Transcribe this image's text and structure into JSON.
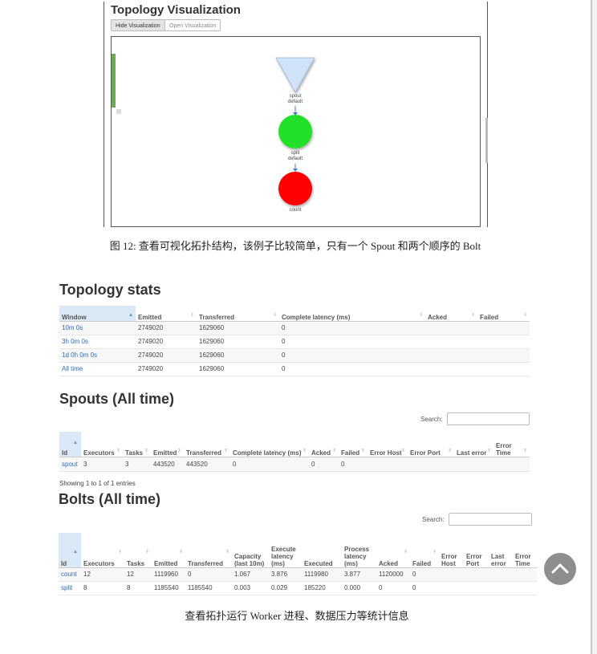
{
  "viz": {
    "title": "Topology Visualization",
    "hide_button": "Hide Visualization",
    "open_button": "Open Visualization",
    "nodes": [
      {
        "label_lines": [
          "spout",
          "default"
        ],
        "shape": "triangle",
        "color": "#cfe2f7"
      },
      {
        "label_lines": [
          "split",
          "default"
        ],
        "shape": "circle",
        "color": "#22e02a"
      },
      {
        "label_lines": [
          "count"
        ],
        "shape": "circle",
        "color": "#ff0000"
      }
    ]
  },
  "caption1": "图 12: 查看可视化拓扑结构，该例子比较简单，只有一个 Spout 和两个顺序的 Bolt",
  "stats": {
    "title": "Topology stats",
    "headers": [
      "Window",
      "Emitted",
      "Transferred",
      "Complete latency (ms)",
      "Acked",
      "Failed"
    ],
    "rows": [
      [
        "10m 0s",
        "2749020",
        "1629060",
        "0",
        "",
        ""
      ],
      [
        "3h 0m 0s",
        "2749020",
        "1629060",
        "0",
        "",
        ""
      ],
      [
        "1d 0h 0m 0s",
        "2749020",
        "1629060",
        "0",
        "",
        ""
      ],
      [
        "All time",
        "2749020",
        "1629060",
        "0",
        "",
        ""
      ]
    ]
  },
  "spouts": {
    "title": "Spouts (All time)",
    "search_label": "Search:",
    "headers": [
      "Id",
      "Executors",
      "Tasks",
      "Emitted",
      "Transferred",
      "Complete latency (ms)",
      "Acked",
      "Failed",
      "Error Host",
      "Error Port",
      "Last error",
      "Error Time"
    ],
    "rows": [
      [
        "spout",
        "3",
        "3",
        "443520",
        "443520",
        "0",
        "0",
        "0",
        "",
        "",
        "",
        ""
      ]
    ],
    "showing": "Showing 1 to 1 of 1 entries"
  },
  "bolts": {
    "title": "Bolts (All time)",
    "search_label": "Search:",
    "headers": [
      "Id",
      "Executors",
      "Tasks",
      "Emitted",
      "Transferred",
      "Capacity (last 10m)",
      "Execute latency (ms)",
      "Executed",
      "Process latency (ms)",
      "Acked",
      "Failed",
      "Error Host",
      "Error Port",
      "Last error",
      "Error Time"
    ],
    "rows": [
      [
        "count",
        "12",
        "12",
        "1119960",
        "0",
        "1.067",
        "3.876",
        "1119980",
        "3.877",
        "1120000",
        "0",
        "",
        "",
        "",
        ""
      ],
      [
        "split",
        "8",
        "8",
        "1185540",
        "1185540",
        "0.003",
        "0.029",
        "185220",
        "0.000",
        "0",
        "0",
        "",
        "",
        "",
        ""
      ]
    ]
  },
  "caption2": "查看拓扑运行 Worker 进程、数据压力等统计信息",
  "colors": {
    "link": "#2a6ab8",
    "active_header": "#dbe8f5",
    "scroll_button": "#8e8e8e"
  },
  "icons": {
    "scroll_top": "chevron-up-icon",
    "sort": "sort-icon"
  }
}
